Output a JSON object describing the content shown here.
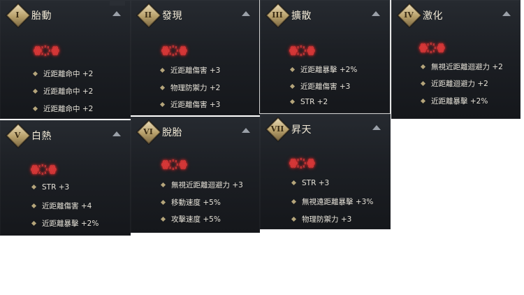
{
  "panels": [
    {
      "roman": "I",
      "title": "胎動",
      "glyph": "ꙮ ꙰ ꙮ",
      "stats": [
        "近距離命中 +2",
        "近距離命中 +2",
        "近距離命中 +2"
      ]
    },
    {
      "roman": "II",
      "title": "發現",
      "glyph": "ꙮ ꙰ ꙮ",
      "stats": [
        "近距離傷害 +3",
        "物理防禦力 +2",
        "近距離傷害 +3"
      ]
    },
    {
      "roman": "III",
      "title": "擴散",
      "glyph": "ꙮ ꙰ ꙮ",
      "stats": [
        "近距離暴擊 +2%",
        "近距離傷害 +3",
        "STR +2"
      ]
    },
    {
      "roman": "IV",
      "title": "激化",
      "glyph": "ꙮ ꙰ ꙮ",
      "stats": [
        "無視近距離迴避力 +2",
        "近距離迴避力 +2",
        "近距離暴擊 +2%"
      ]
    },
    {
      "roman": "V",
      "title": "白熱",
      "glyph": "ꙮ ꙰ ꙮ",
      "stats": [
        "STR +3",
        "近距離傷害 +4",
        "近距離暴擊 +2%"
      ]
    },
    {
      "roman": "VI",
      "title": "脫胎",
      "glyph": "ꙮ ꙰ ꙮ",
      "stats": [
        "無視近距離迴避力 +3",
        "移動速度 +5%",
        "攻擊速度 +5%"
      ]
    },
    {
      "roman": "VII",
      "title": "昇天",
      "glyph": "ꙮ ꙰ ꙮ",
      "stats": [
        "STR +3",
        "無視遠距離暴擊 +3%",
        "物理防禦力 +3"
      ]
    }
  ]
}
